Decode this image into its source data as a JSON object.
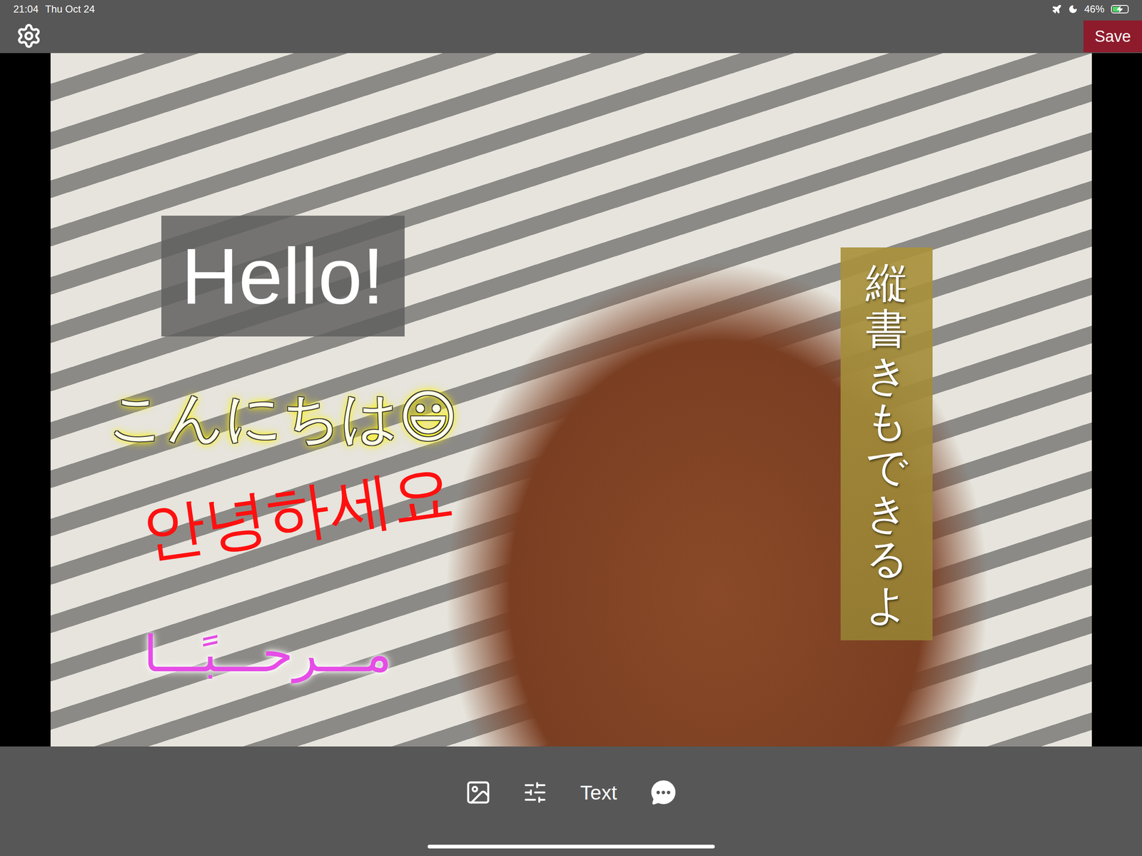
{
  "status_bar": {
    "time": "21:04",
    "date": "Thu Oct 24",
    "battery": "46%",
    "battery_level": 0.46,
    "charging": true,
    "airplane_mode": true,
    "do_not_disturb": true
  },
  "toolbar": {
    "save_button": "Save"
  },
  "canvas": {
    "text_layers": [
      {
        "kind": "boxed",
        "text": "Hello!",
        "color": "#ffffff"
      },
      {
        "kind": "outlined",
        "text": "こんにちは😃",
        "color": "#fffde6"
      },
      {
        "kind": "rotated",
        "text": "안녕하세요",
        "color": "#ff1010"
      },
      {
        "kind": "glow",
        "text": "مـــرحـــبًـــا",
        "color": "#e64ce6"
      },
      {
        "kind": "vertical",
        "text": "縦書きもできるよ",
        "color": "#ffffff"
      }
    ]
  },
  "bottom_toolbar": {
    "text_button": "Text"
  }
}
